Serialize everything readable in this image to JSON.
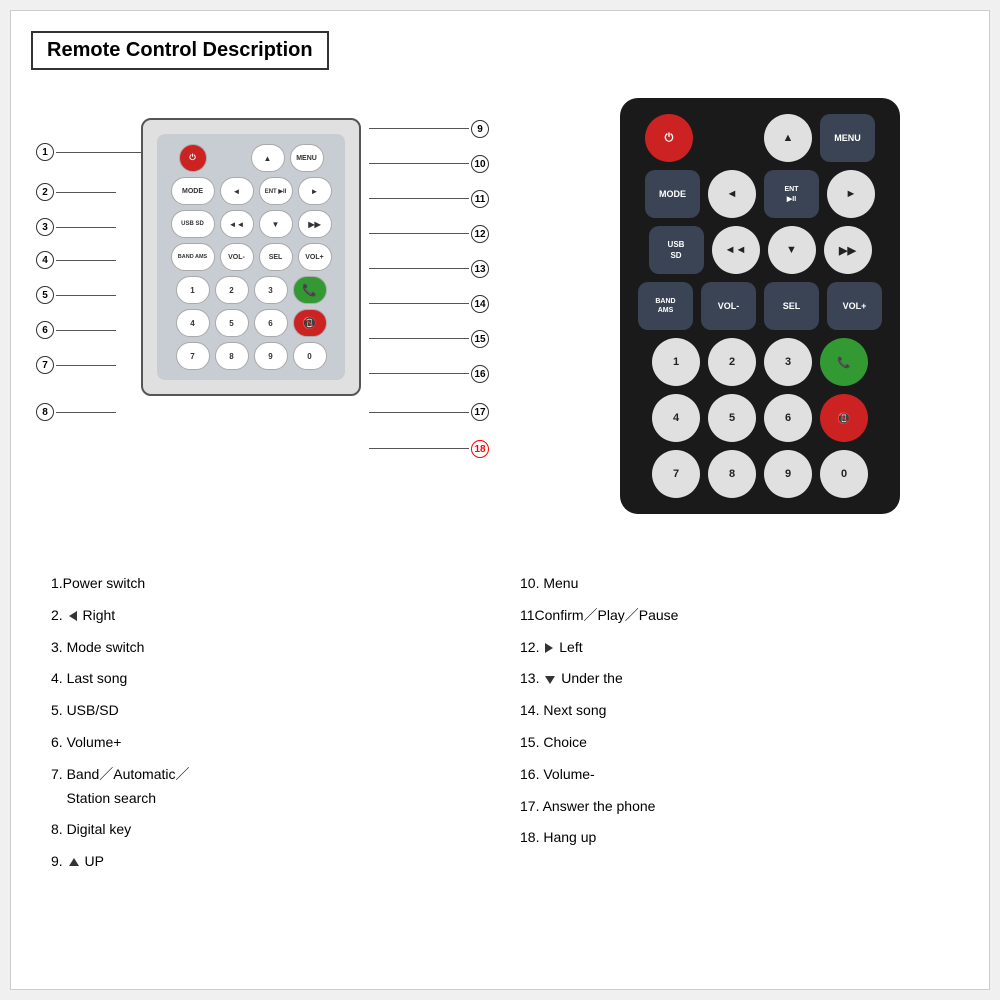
{
  "title": "Remote Control Description",
  "diagram": {
    "buttons": {
      "row1": [
        "POWER",
        "▲",
        "MENU"
      ],
      "row2": [
        "MODE",
        "◄",
        "ENT ▶II",
        "►"
      ],
      "row3": [
        "USB/SD",
        "◄◄",
        "▼",
        "▶▶"
      ],
      "row4": [
        "BAND AMS",
        "VOL-",
        "SEL",
        "VOL+"
      ],
      "row5": [
        "1",
        "2",
        "3",
        "✆"
      ],
      "row6": [
        "4",
        "5",
        "6",
        "📵"
      ],
      "row7": [
        "7",
        "8",
        "9",
        "0"
      ]
    }
  },
  "callouts": [
    {
      "num": "1",
      "label": "Power switch"
    },
    {
      "num": "2",
      "label": "◄ Right"
    },
    {
      "num": "3",
      "label": "Mode switch"
    },
    {
      "num": "4",
      "label": "Last song"
    },
    {
      "num": "5",
      "label": "USB/SD"
    },
    {
      "num": "6",
      "label": "Volume+"
    },
    {
      "num": "7",
      "label": "Band／Automatic／Station search"
    },
    {
      "num": "8",
      "label": "Digital key"
    },
    {
      "num": "9",
      "label": "▲ UP"
    },
    {
      "num": "10",
      "label": "Menu"
    },
    {
      "num": "11",
      "label": "Confirm／Play／Pause"
    },
    {
      "num": "12",
      "label": "► Left"
    },
    {
      "num": "13",
      "label": "▼ Under the"
    },
    {
      "num": "14",
      "label": "Next song"
    },
    {
      "num": "15",
      "label": "Choice"
    },
    {
      "num": "16",
      "label": "Volume-"
    },
    {
      "num": "17",
      "label": "Answer the phone"
    },
    {
      "num": "18",
      "label": "Hang up"
    }
  ],
  "desc_left": [
    "1.Power switch",
    "2. ◄ Right",
    "3. Mode switch",
    "4. Last song",
    "5. USB/SD",
    "6. Volume+",
    "7. Band／Automatic／\n   Station search",
    "8. Digital key",
    "9. ▲ UP"
  ],
  "desc_right": [
    "10. Menu",
    "11Confirm／Play／Pause",
    "12. ► Left",
    "13. ▼ Under the",
    "14. Next song",
    "15. Choice",
    "16. Volume-",
    "17. Answer the phone",
    "18. Hang up"
  ]
}
